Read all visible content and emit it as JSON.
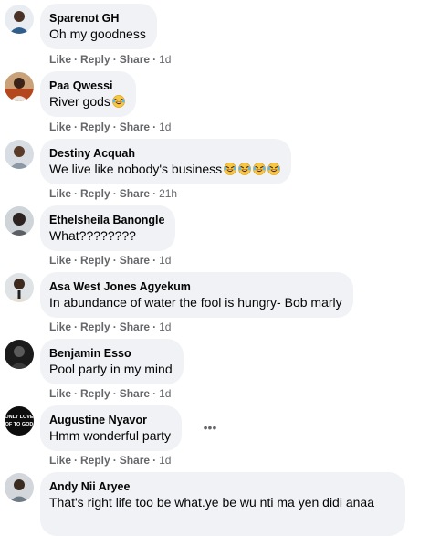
{
  "actions": {
    "like": "Like",
    "reply": "Reply",
    "share": "Share",
    "separator": "·"
  },
  "comments": [
    {
      "name": "Sparenot GH",
      "text": "Oh my goodness",
      "time": "1d",
      "emoji_count": 0
    },
    {
      "name": "Paa Qwessi",
      "text": "River gods",
      "time": "1d",
      "emoji_count": 1
    },
    {
      "name": "Destiny Acquah",
      "text": "We live like nobody's business",
      "time": "21h",
      "emoji_count": 4
    },
    {
      "name": "Ethelsheila Banongle",
      "text": "What????????",
      "time": "1d",
      "emoji_count": 0
    },
    {
      "name": "Asa West Jones Agyekum",
      "text": "In abundance of water the fool is hungry- Bob marly",
      "time": "1d",
      "emoji_count": 0
    },
    {
      "name": "Benjamin Esso",
      "text": "Pool party in my mind",
      "time": "1d",
      "emoji_count": 0
    },
    {
      "name": "Augustine Nyavor",
      "text": "Hmm wonderful party",
      "time": "1d",
      "emoji_count": 0,
      "avatar_text": "ONLY LOVE OF TO GOD"
    },
    {
      "name": "Andy Nii Aryee",
      "text": "That's right life too be what.ye be wu nti ma yen didi anaa",
      "time": "",
      "emoji_count": 0
    }
  ],
  "icons": {
    "emoji": "rolling-on-floor-laughing-icon",
    "more": "more-options-icon"
  },
  "colors": {
    "bubble": "#f0f2f5",
    "meta": "#65676b",
    "text": "#050505"
  }
}
